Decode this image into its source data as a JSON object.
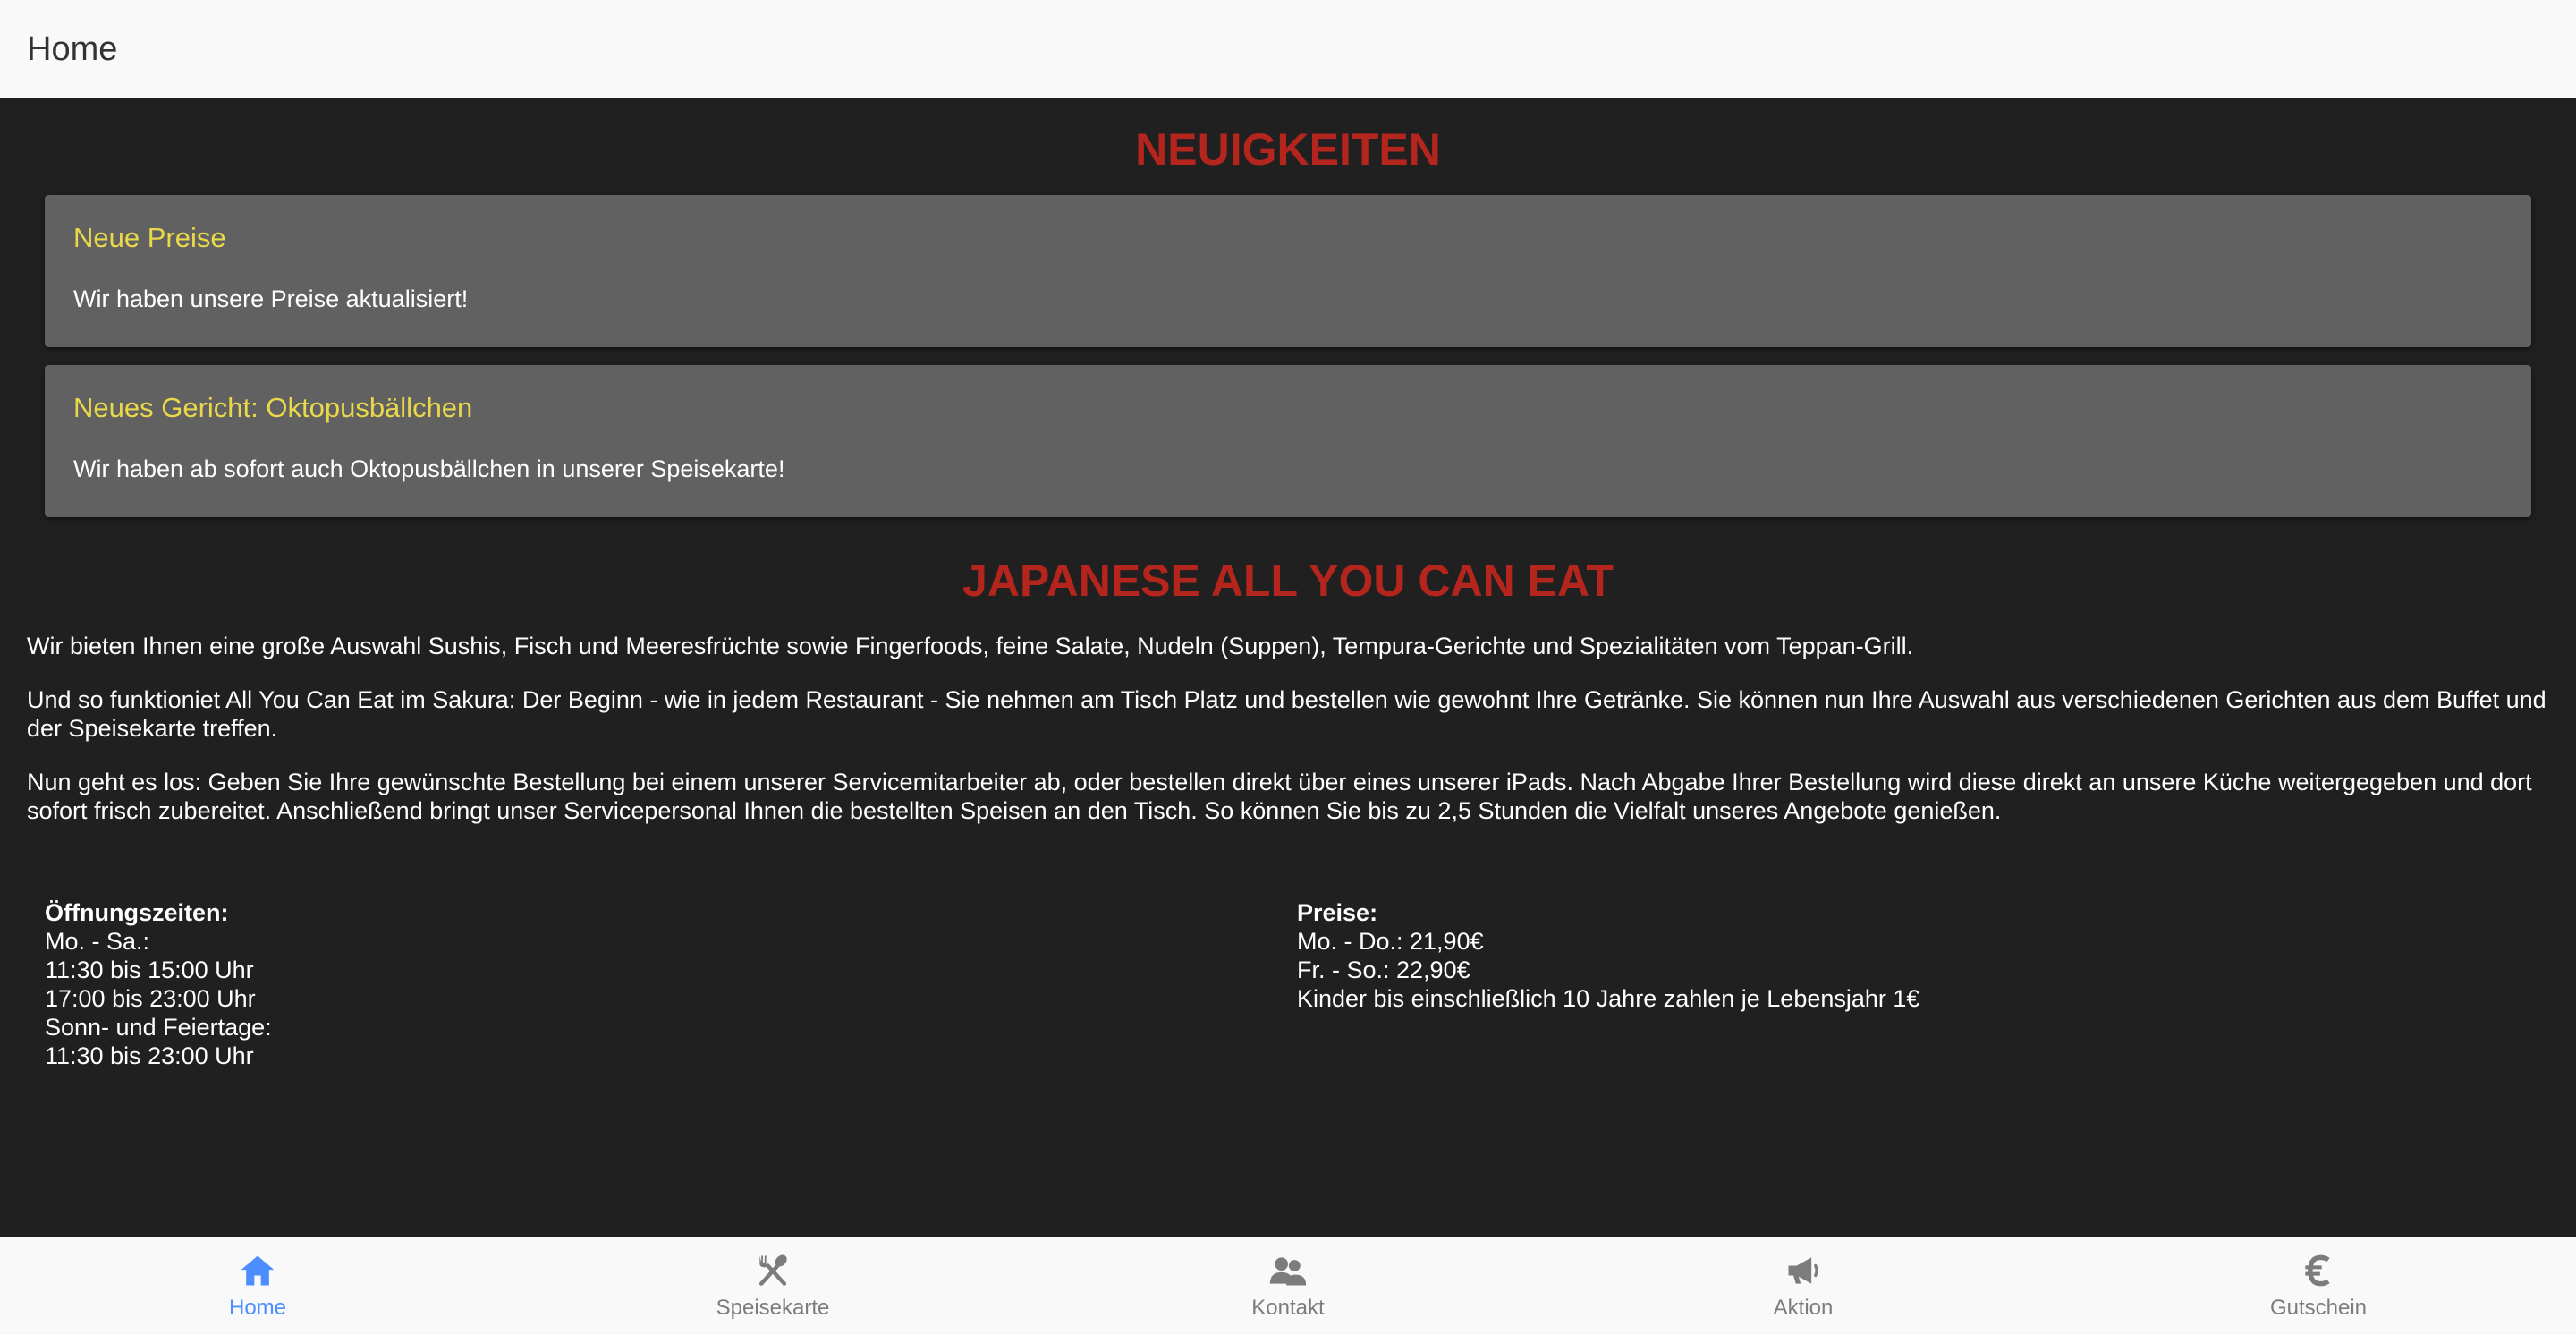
{
  "header": {
    "title": "Home"
  },
  "news": {
    "title": "NEUIGKEITEN",
    "items": [
      {
        "title": "Neue Preise",
        "text": "Wir haben unsere Preise aktualisiert!"
      },
      {
        "title": "Neues Gericht: Oktopusbällchen",
        "text": "Wir haben ab sofort auch Oktopusbällchen in unserer Speisekarte!"
      }
    ]
  },
  "ayce": {
    "title": "JAPANESE ALL YOU CAN EAT",
    "paragraphs": [
      "Wir bieten Ihnen eine große Auswahl Sushis, Fisch und Meeresfrüchte sowie Fingerfoods, feine Salate, Nudeln (Suppen), Tempura-Gerichte und Spezialitäten vom Teppan-Grill.",
      "Und so funktioniet All You Can Eat im Sakura: Der Beginn - wie in jedem Restaurant - Sie nehmen am Tisch Platz und bestellen wie gewohnt Ihre Getränke. Sie können nun Ihre Auswahl aus verschiedenen Gerichten aus dem Buffet und der Speisekarte treffen.",
      "Nun geht es los: Geben Sie Ihre gewünschte Bestellung bei einem unserer Servicemitarbeiter ab, oder bestellen direkt über eines unserer iPads. Nach Abgabe Ihrer Bestellung wird diese direkt an unsere Küche weitergegeben und dort sofort frisch zubereitet. Anschließend bringt unser Servicepersonal Ihnen die bestellten Speisen an den Tisch. So können Sie bis zu 2,5 Stunden die Vielfalt unseres Angebote genießen."
    ]
  },
  "hours": {
    "heading": "Öffnungszeiten:",
    "lines": [
      "Mo. - Sa.:",
      "11:30 bis 15:00 Uhr",
      "17:00 bis 23:00 Uhr",
      "Sonn- und Feiertage:",
      "11:30 bis 23:00 Uhr"
    ]
  },
  "prices": {
    "heading": "Preise:",
    "lines": [
      "Mo. - Do.: 21,90€",
      "Fr. - So.: 22,90€",
      "Kinder bis einschließlich 10 Jahre zahlen je Lebensjahr 1€"
    ]
  },
  "tabs": [
    {
      "label": "Home",
      "icon": "home-icon",
      "active": true
    },
    {
      "label": "Speisekarte",
      "icon": "cutlery-icon",
      "active": false
    },
    {
      "label": "Kontakt",
      "icon": "people-icon",
      "active": false
    },
    {
      "label": "Aktion",
      "icon": "megaphone-icon",
      "active": false
    },
    {
      "label": "Gutschein",
      "icon": "euro-icon",
      "active": false
    }
  ],
  "colors": {
    "accent_red": "#b3251d",
    "card_title_yellow": "#e9d94a",
    "tab_active_blue": "#4c8dff",
    "tab_inactive_gray": "#7c7c7c"
  }
}
